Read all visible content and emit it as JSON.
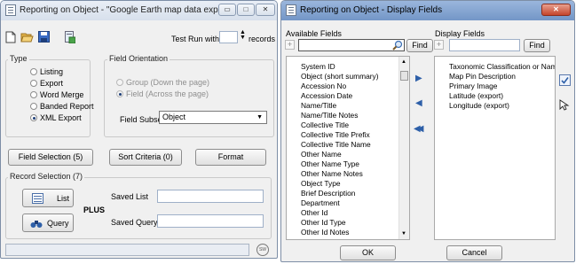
{
  "win1": {
    "title": "Reporting on Object - \"Google Earth map data export\"",
    "controls": {
      "minimize": "▭",
      "maximize": "□",
      "close": "✕"
    },
    "toolbar": {
      "test_run_label": "Test Run with",
      "test_run_value": "",
      "records_label": "records"
    },
    "type_group": {
      "label": "Type",
      "options": [
        {
          "label": "Listing",
          "selected": false
        },
        {
          "label": "Export",
          "selected": false
        },
        {
          "label": "Word Merge",
          "selected": false
        },
        {
          "label": "Banded Report",
          "selected": false
        },
        {
          "label": "XML Export",
          "selected": true
        }
      ]
    },
    "orientation_group": {
      "label": "Field Orientation",
      "options": [
        {
          "label": "Group (Down the page)",
          "selected": false,
          "disabled": true
        },
        {
          "label": "Field (Across the page)",
          "selected": true,
          "disabled": true
        }
      ],
      "subset_label": "Field Subset",
      "subset_value": "Object"
    },
    "buttons": {
      "field_selection": "Field Selection (5)",
      "sort_criteria": "Sort Criteria (0)",
      "format": "Format"
    },
    "record_selection": {
      "label": "Record Selection (7)",
      "list_label": "List",
      "query_label": "Query",
      "plus": "PLUS",
      "saved_list_label": "Saved List",
      "saved_list_value": "",
      "saved_query_label": "Saved Query",
      "saved_query_value": ""
    },
    "status": {
      "text": ""
    }
  },
  "win2": {
    "title": "Reporting on Object - Display Fields",
    "close": "✕",
    "available": {
      "label": "Available Fields",
      "search_value": "",
      "find_label": "Find",
      "items": [
        "System ID",
        "Object (short summary)",
        "Accession No",
        "Accession Date",
        "Name/Title",
        "Name/Title Notes",
        "Collective Title",
        "Collective Title Prefix",
        "Collective Title Name",
        "Other Name",
        "Other Name Type",
        "Other Name Notes",
        "Object Type",
        "Brief Description",
        "Department",
        "Other Id",
        "Other Id Type",
        "Other Id Notes"
      ]
    },
    "display": {
      "label": "Display Fields",
      "search_value": "",
      "find_label": "Find",
      "items": [
        "Taxonomic Classification or Nam",
        "Map Pin Description",
        "Primary Image",
        "Latitude (export)",
        "Longitude (export)"
      ]
    },
    "ok_label": "OK",
    "cancel_label": "Cancel"
  },
  "colors": {
    "accent": "#2d5fa8",
    "title_active": "#7396c7",
    "close_red": "#c4452c"
  }
}
